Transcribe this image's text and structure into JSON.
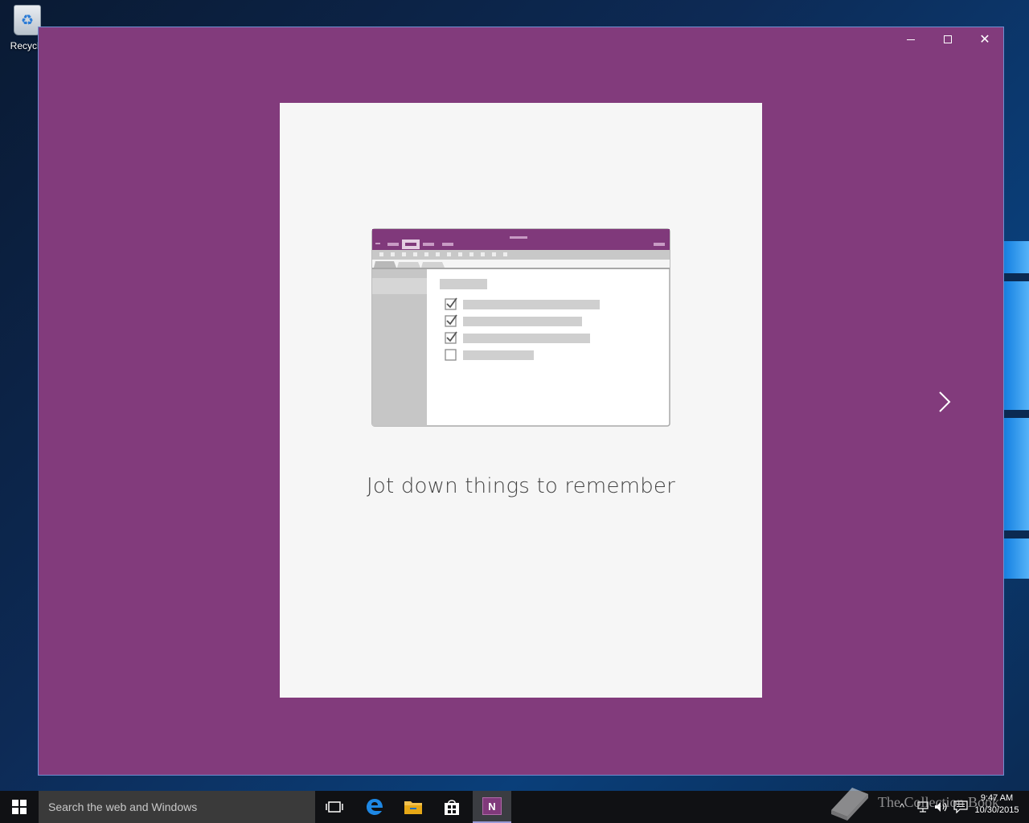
{
  "desktop": {
    "recycle_bin_label": "Recycle"
  },
  "window": {
    "background_color": "#823b7c",
    "controls": {
      "minimize": "minimize",
      "maximize": "maximize",
      "close": "close"
    }
  },
  "intro_card": {
    "caption": "Jot down things to remember",
    "checklist": [
      {
        "checked": true
      },
      {
        "checked": true
      },
      {
        "checked": true
      },
      {
        "checked": false
      }
    ]
  },
  "taskbar": {
    "search_placeholder": "Search the web and Windows",
    "watermark": "The Collection Book",
    "time": "9:47 AM",
    "date": "10/30/2015"
  }
}
